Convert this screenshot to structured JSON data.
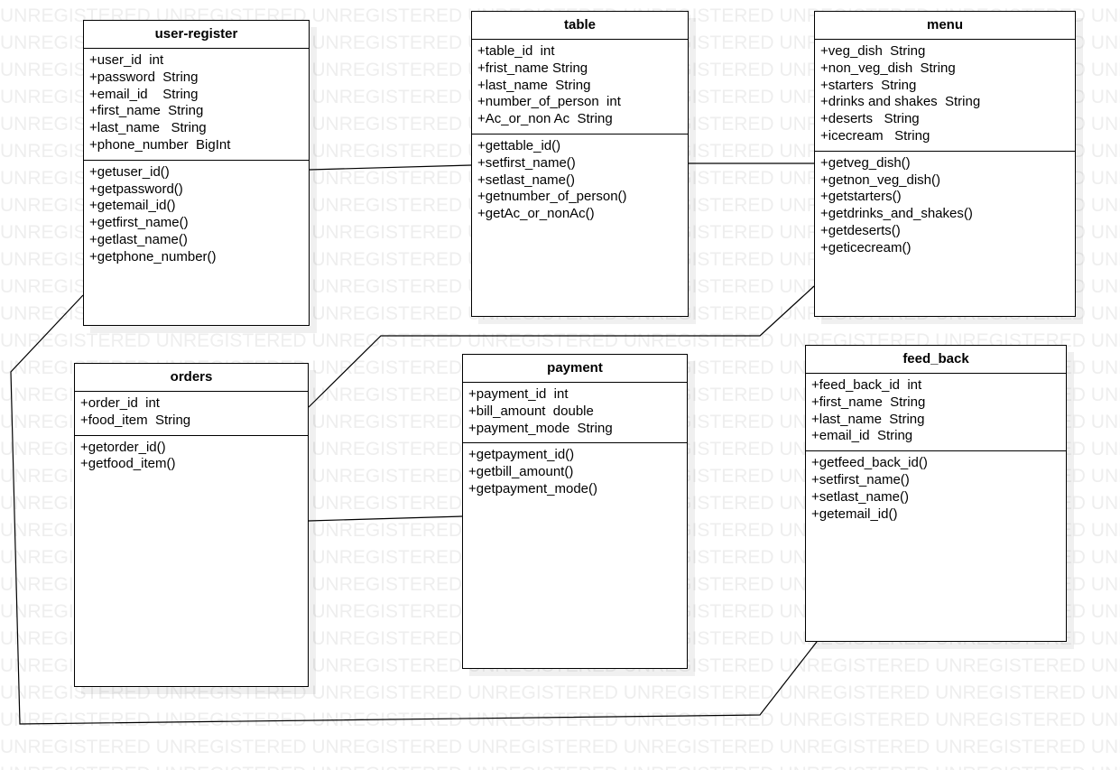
{
  "watermark_text": "UNREGISTERED",
  "classes": {
    "user_register": {
      "name": "user-register",
      "attributes": [
        "+user_id  int",
        "+password  String",
        "+email_id    String",
        "+first_name  String",
        "+last_name   String",
        "+phone_number  BigInt"
      ],
      "methods": [
        "+getuser_id()",
        "+getpassword()",
        "+getemail_id()",
        "+getfirst_name()",
        "+getlast_name()",
        "+getphone_number()"
      ]
    },
    "table": {
      "name": "table",
      "attributes": [
        "+table_id  int",
        "+frist_name String",
        "+last_name  String",
        "+number_of_person  int",
        "+Ac_or_non Ac  String"
      ],
      "methods": [
        "+gettable_id()",
        "+setfirst_name()",
        "+setlast_name()",
        "+getnumber_of_person()",
        "+getAc_or_nonAc()"
      ]
    },
    "menu": {
      "name": "menu",
      "attributes": [
        "+veg_dish  String",
        "+non_veg_dish  String",
        "+starters  String",
        "+drinks and shakes  String",
        "+deserts   String",
        "+icecream   String"
      ],
      "methods": [
        "+getveg_dish()",
        "+getnon_veg_dish()",
        "+getstarters()",
        "+getdrinks_and_shakes()",
        "+getdeserts()",
        "+geticecream()"
      ]
    },
    "orders": {
      "name": "orders",
      "attributes": [
        "+order_id  int",
        "+food_item  String"
      ],
      "methods": [
        "+getorder_id()",
        "+getfood_item()"
      ]
    },
    "payment": {
      "name": "payment",
      "attributes": [
        "+payment_id  int",
        "+bill_amount  double",
        "+payment_mode  String"
      ],
      "methods": [
        "+getpayment_id()",
        "+getbill_amount()",
        "+getpayment_mode()"
      ]
    },
    "feed_back": {
      "name": "feed_back",
      "attributes": [
        "+feed_back_id  int",
        "+first_name  String",
        "+last_name  String",
        "+email_id  String"
      ],
      "methods": [
        "+getfeed_back_id()",
        "+setfirst_name()",
        "+setlast_name()",
        "+getemail_id()"
      ]
    }
  }
}
